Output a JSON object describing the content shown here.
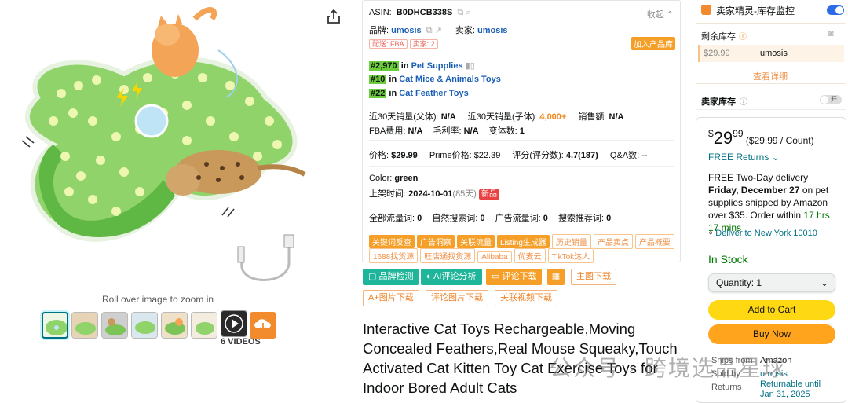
{
  "gallery": {
    "zoom_hint": "Roll over image to zoom in",
    "videos_label": "6 VIDEOS",
    "icons": [
      "share-icon",
      "play-icon",
      "upload-icon"
    ]
  },
  "panel": {
    "asin_label": "ASIN:",
    "asin": "B0DHCB338S",
    "collapse": "收起",
    "brand_label": "品牌:",
    "brand": "umosis",
    "seller_label": "卖家:",
    "seller": "umosis",
    "tag_fba": "配送: FBA",
    "tag_sellers": "卖家: 2",
    "add_library": "加入产品库",
    "ranks": [
      {
        "rank": "#2,970",
        "in": "in",
        "category": "Pet Supplies"
      },
      {
        "rank": "#10",
        "in": "in",
        "category": "Cat Mice & Animals Toys"
      },
      {
        "rank": "#22",
        "in": "in",
        "category": "Cat Feather Toys"
      }
    ],
    "sales_parent_label": "近30天销量(父体):",
    "sales_parent": "N/A",
    "sales_child_label": "近30天销量(子体):",
    "sales_child": "4,000+",
    "revenue_label": "销售额:",
    "revenue": "N/A",
    "fba_fee_label": "FBA费用:",
    "fba_fee": "N/A",
    "margin_label": "毛利率:",
    "margin": "N/A",
    "variants_label": "变体数:",
    "variants": "1",
    "price_label": "价格:",
    "price": "$29.99",
    "prime_label": "Prime价格:",
    "prime": "$22.39",
    "rating_label": "评分(评分数):",
    "rating": "4.7(187)",
    "qa_label": "Q&A数:",
    "qa": "--",
    "color_label": "Color:",
    "color": "green",
    "listed_label": "上架时间:",
    "listed": "2024-10-01",
    "listed_days": "(85天)",
    "new_badge": "新品",
    "traffic_all_label": "全部流量词:",
    "traffic_all": "0",
    "traffic_organic_label": "自然搜索词:",
    "traffic_organic": "0",
    "traffic_ad_label": "广告流量词:",
    "traffic_ad": "0",
    "traffic_rec_label": "搜索推荐词:",
    "traffic_rec": "0",
    "chips_row1": [
      {
        "label": "关键词反查",
        "style": "f"
      },
      {
        "label": "广告洞察",
        "style": "f"
      },
      {
        "label": "关联流量",
        "style": "f"
      },
      {
        "label": "Listing生成器",
        "style": "f"
      },
      {
        "label": "历史销量",
        "style": "o"
      },
      {
        "label": "产品卖点",
        "style": "o"
      },
      {
        "label": "产品概要",
        "style": "o"
      }
    ],
    "chips_row2": [
      "1688找货源",
      "旺店通找货源",
      "Alibaba",
      "优麦云",
      "TikTok达人"
    ]
  },
  "actions": {
    "brand_check": "品牌检测",
    "ai_review": "AI评论分析",
    "review_download": "评论下载",
    "main_download": "主图下载",
    "aplus_download": "A+图片下载",
    "review_img_download": "评论图片下载",
    "related_video_download": "关联视频下载"
  },
  "product": {
    "title": "Interactive Cat Toys Rechargeable,Moving Concealed Feathers,Real Mouse Squeaky,Touch Activated Cat Kitten Toy Cat Exercise Toys for Indoor Bored Adult Cats"
  },
  "monitor": {
    "label": "卖家精灵-库存监控",
    "toggle_on": true,
    "remaining_label": "剩余库存",
    "row_price": "$29.99",
    "row_seller": "umosis",
    "view_detail": "查看详细",
    "seller_stock_label": "卖家库存",
    "seller_stock_toggle": "开"
  },
  "buybox": {
    "price_symbol": "$",
    "price_whole": "29",
    "price_fraction": "99",
    "price_unit": "($29.99 / Count)",
    "free_returns": "FREE Returns",
    "delivery_1": "FREE Two-Day delivery ",
    "delivery_date": "Friday, December 27",
    "delivery_2": " on pet supplies shipped by Amazon over $35.",
    "order_within_label": "Order within ",
    "order_within": "17 hrs 17 mins",
    "deliver_to": "Deliver to New York 10010",
    "stock": "In Stock",
    "quantity": "Quantity: 1",
    "add_to_cart": "Add to Cart",
    "buy_now": "Buy Now",
    "ships_from_label": "Ships from",
    "ships_from": "Amazon",
    "sold_by_label": "Sold by",
    "sold_by": "umosis",
    "returns_label": "Returns",
    "returns": "Returnable until Jan 31, 2025"
  },
  "overlay": {
    "watermark": "公众号 · 跨境选品星球"
  },
  "colors": {
    "accent_teal": "#007185",
    "rank_green": "#6bcf3c",
    "orange": "#f59f28",
    "add_to_cart": "#ffd814",
    "buy_now": "#ffa41c",
    "in_stock": "#007600"
  }
}
